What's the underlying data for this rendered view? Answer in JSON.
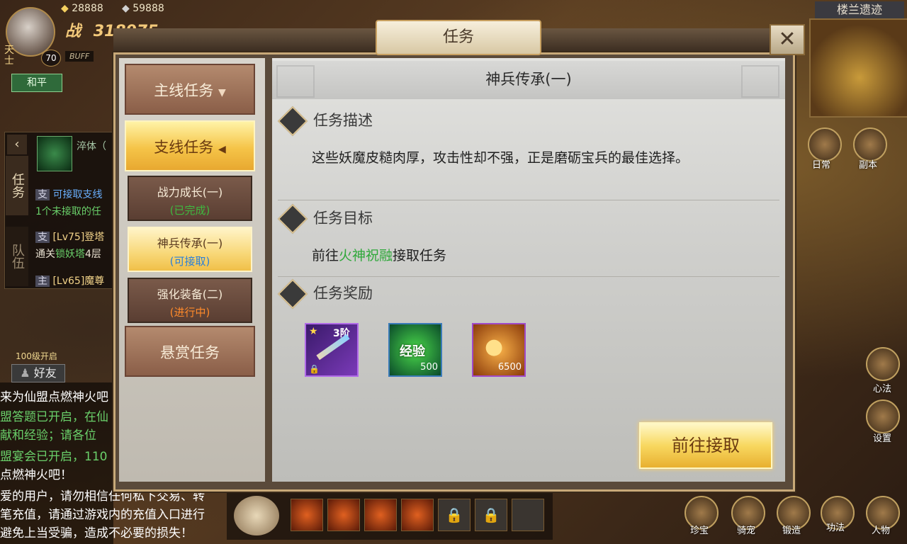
{
  "hud": {
    "currency1": "28888",
    "currency2": "59888",
    "player_level": "70",
    "power_label": "战",
    "power_value": "318975",
    "buff_label": "BUFF",
    "pk_mode": "和平",
    "name_partial": "天\n士"
  },
  "side_panel": {
    "tab_task": "任务",
    "tab_team": "队伍",
    "item_partial": "淬体（",
    "tasks": [
      {
        "tag": "支",
        "text": "可接取支线",
        "sub": "1个未接取的任"
      },
      {
        "tag": "支",
        "text": "[Lv75]登塔",
        "sub_prefix": "通关",
        "sub_green": "锁妖塔",
        "sub_suffix": "4层"
      },
      {
        "tag": "主",
        "text": "[Lv65]魔尊"
      }
    ],
    "friends_unlock": "100级开启",
    "friends_label": "好友"
  },
  "chat": [
    "来为仙盟点燃神火吧",
    "盟答题已开启，在仙",
    "献和经验；请各位",
    "盟宴会已开启，110",
    "点燃神火吧！",
    "爱的用户，请勿相信任何私下交易、转",
    "笔充值，请通过游戏内的充值入口进行",
    "避免上当受骗，造成不必要的损失！"
  ],
  "right_hud": {
    "map_title": "楼兰遗迹",
    "daily": "日常",
    "dungeon": "副本",
    "mental": "心法",
    "settings": "设置",
    "bottom": [
      "珍宝",
      "骑宠",
      "锻造",
      "功法",
      "人物"
    ]
  },
  "dialog": {
    "title": "任务",
    "categories": {
      "main": "主线任务",
      "side": "支线任务",
      "bounty": "悬赏任务"
    },
    "sub_tasks": [
      {
        "name": "战力成长(一)",
        "status": "(已完成)",
        "status_color": "#3fb83f"
      },
      {
        "name": "神兵传承(一)",
        "status": "(可接取)",
        "status_color": "#2b7fd8"
      },
      {
        "name": "强化装备(二)",
        "status": "(进行中)",
        "status_color": "#ff8a2a"
      }
    ],
    "detail": {
      "title": "神兵传承(一)",
      "desc_head": "任务描述",
      "desc": "这些妖魔皮糙肉厚，攻击性却不强，正是磨砺宝兵的最佳选择。",
      "goal_head": "任务目标",
      "goal_prefix": "前往",
      "goal_npc": "火神祝融",
      "goal_suffix": "接取任务",
      "reward_head": "任务奖励",
      "rewards": [
        {
          "name": "weapon-reward",
          "grade": "3阶",
          "count": ""
        },
        {
          "name": "exp-reward",
          "label": "经验",
          "count": "500"
        },
        {
          "name": "coin-reward",
          "count": "6500"
        }
      ],
      "go_button": "前往接取"
    }
  }
}
